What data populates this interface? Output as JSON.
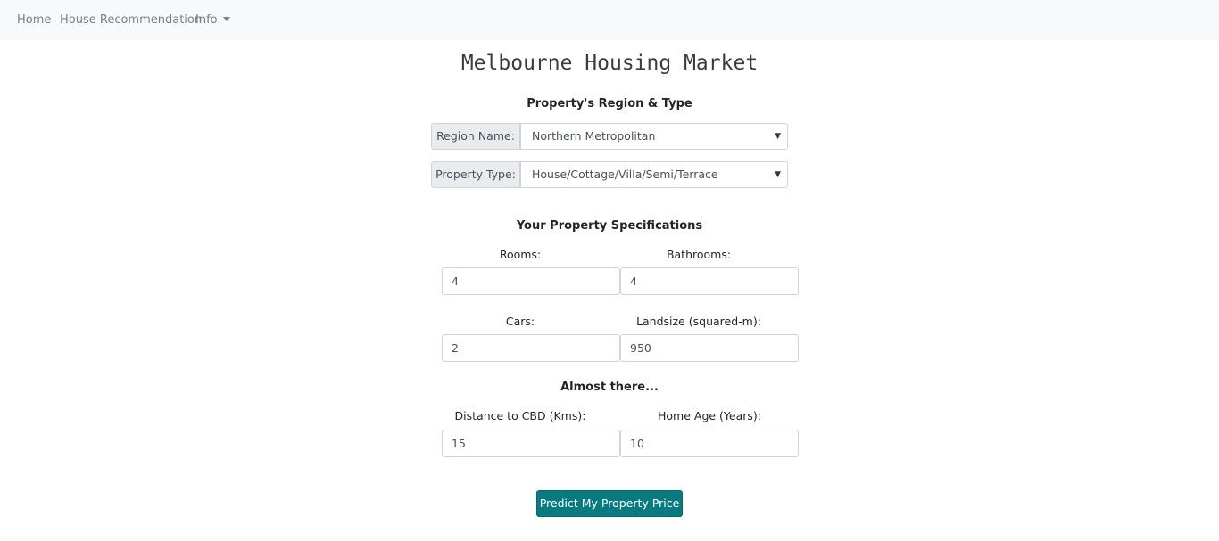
{
  "nav": {
    "home": "Home",
    "house_recommendation": "House Recommendation",
    "info": "Info"
  },
  "title": "Melbourne Housing Market",
  "region_section": {
    "heading": "Property's Region & Type",
    "region_label": "Region Name:",
    "region_value": "Northern Metropolitan",
    "type_label": "Property Type:",
    "type_value": "House/Cottage/Villa/Semi/Terrace"
  },
  "specs_section": {
    "heading": "Your Property Specifications",
    "rooms_label": "Rooms:",
    "rooms_value": "4",
    "bathrooms_label": "Bathrooms:",
    "bathrooms_value": "4",
    "cars_label": "Cars:",
    "cars_value": "2",
    "landsize_label": "Landsize (squared-m):",
    "landsize_value": "950"
  },
  "almost_section": {
    "heading": "Almost there...",
    "distance_label": "Distance to CBD (Kms):",
    "distance_value": "15",
    "age_label": "Home Age (Years):",
    "age_value": "10"
  },
  "submit_label": "Predict My Property Price",
  "colors": {
    "navbar_bg": "#f8f9fa",
    "button_bg": "#077b7f",
    "addon_bg": "#e9ecef",
    "border": "#ced4da"
  }
}
